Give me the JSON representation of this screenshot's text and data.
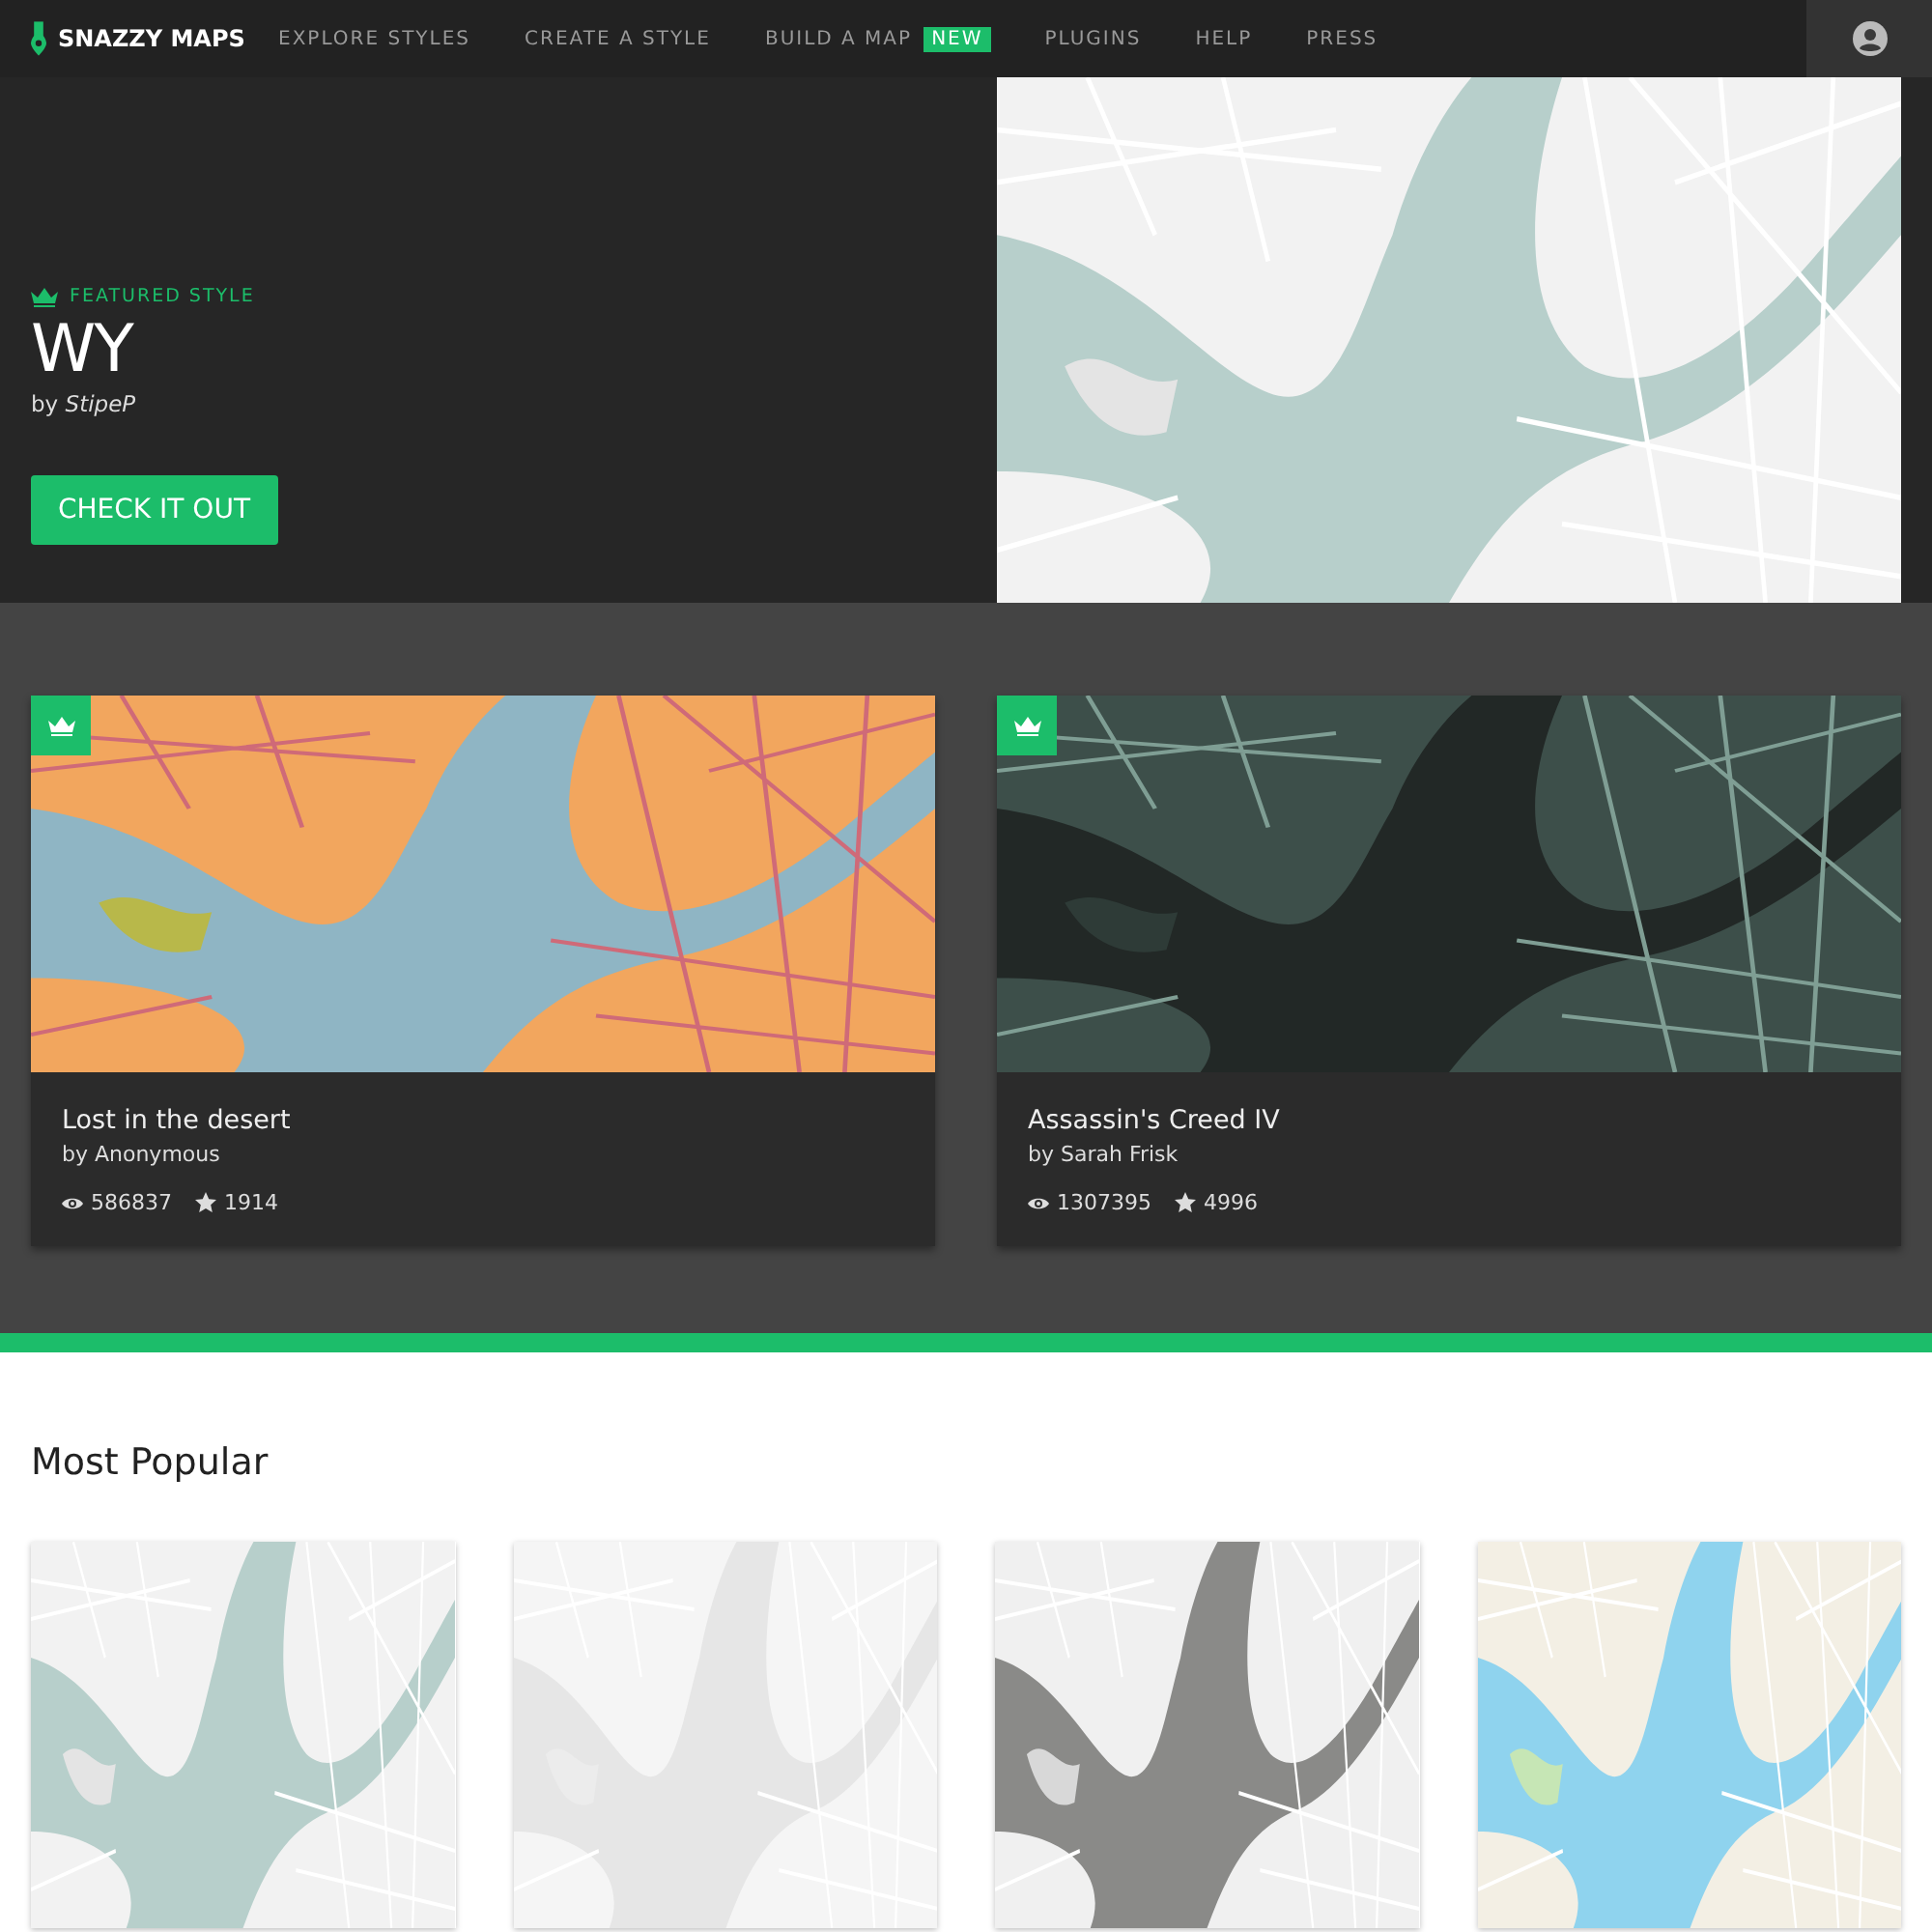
{
  "nav": {
    "brand": "SNAZZY MAPS",
    "items": [
      {
        "label": "EXPLORE STYLES"
      },
      {
        "label": "CREATE A STYLE"
      },
      {
        "label": "BUILD A MAP",
        "badge": "NEW"
      },
      {
        "label": "PLUGINS"
      },
      {
        "label": "HELP"
      },
      {
        "label": "PRESS"
      }
    ]
  },
  "featured": {
    "eyebrow": "FEATURED STYLE",
    "title": "WY",
    "byline": "by *StipeP*",
    "button": "CHECK IT OUT",
    "map": {
      "kind": "light"
    }
  },
  "cards": [
    {
      "title": "Lost in the desert",
      "author": "by Anonymous",
      "views": "586837",
      "stars_count": "1914",
      "featured": true,
      "map": {
        "kind": "desert"
      }
    },
    {
      "title": "Assassin's Creed IV",
      "author": "by Sarah Frisk",
      "views": "1307395",
      "stars_count": "4996",
      "featured": true,
      "map": {
        "kind": "dark"
      }
    }
  ],
  "popular": {
    "title": "Most Popular",
    "tiles": [
      {
        "kind": "light"
      },
      {
        "kind": "pale"
      },
      {
        "kind": "grey"
      },
      {
        "kind": "colorful"
      }
    ]
  }
}
